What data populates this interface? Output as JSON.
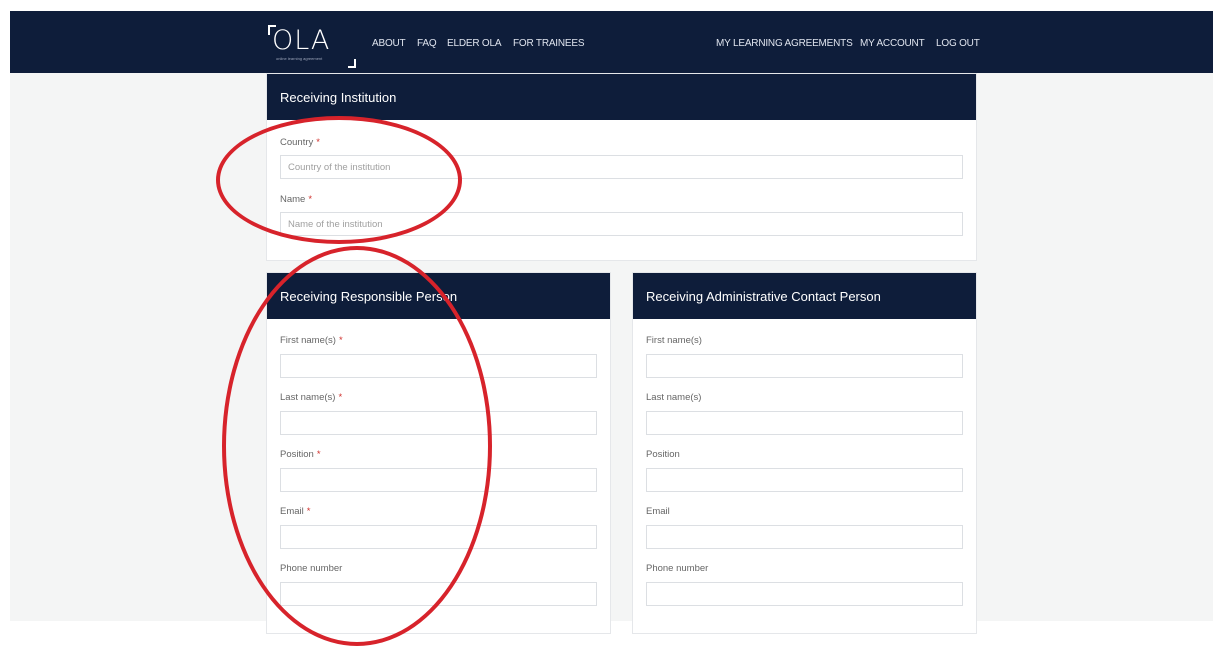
{
  "logo": {
    "text": "OLA",
    "tagline": "online learning agreement"
  },
  "nav": {
    "left": [
      "ABOUT",
      "FAQ",
      "ELDER OLA",
      "FOR TRAINEES"
    ],
    "right": [
      "MY LEARNING AGREEMENTS",
      "MY ACCOUNT",
      "LOG OUT"
    ]
  },
  "institution": {
    "title": "Receiving Institution",
    "country_label": "Country",
    "country_placeholder": "Country of the institution",
    "name_label": "Name",
    "name_placeholder": "Name of the institution",
    "required_mark": "*"
  },
  "responsible": {
    "title": "Receiving Responsible Person",
    "first_name_label": "First name(s)",
    "last_name_label": "Last name(s)",
    "position_label": "Position",
    "email_label": "Email",
    "phone_label": "Phone number",
    "required_mark": "*"
  },
  "admin": {
    "title": "Receiving Administrative Contact Person",
    "first_name_label": "First name(s)",
    "last_name_label": "Last name(s)",
    "position_label": "Position",
    "email_label": "Email",
    "phone_label": "Phone number"
  },
  "colors": {
    "navbar": "#0e1d3a",
    "required": "#d0312d",
    "annotation": "#d7232b"
  }
}
